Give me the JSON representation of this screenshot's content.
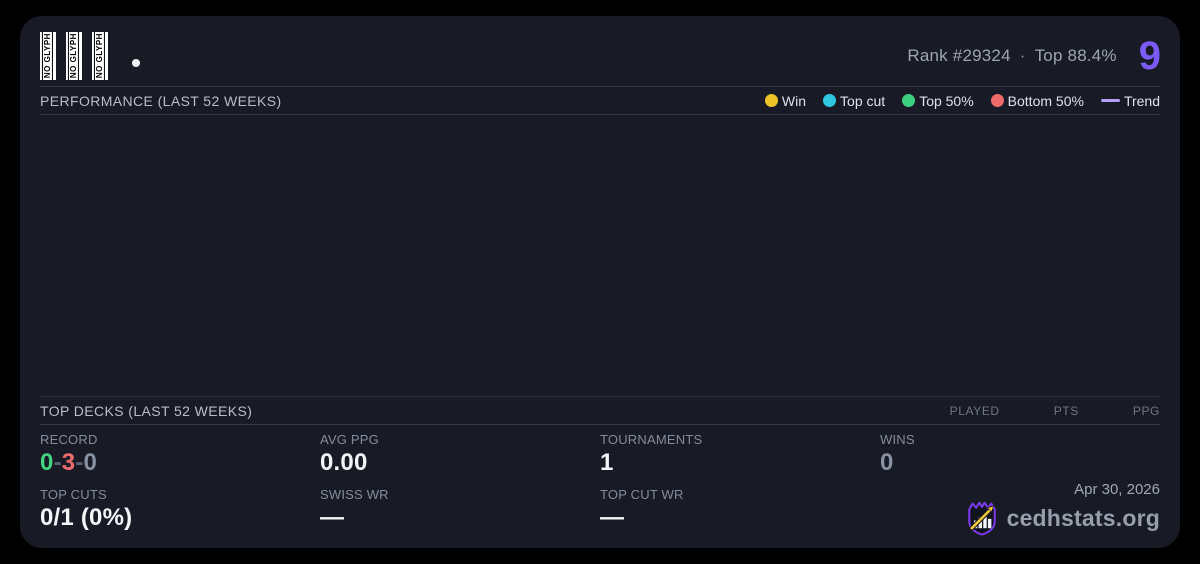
{
  "header": {
    "deck_title": {
      "missing_glyphs": [
        "NO GLYPH",
        "NO GLYPH",
        "NO GLYPH"
      ],
      "suffix_dot": "•"
    },
    "rank_text": "Rank #29324",
    "separator": "·",
    "top_percent": "Top 88.4%",
    "score": "9"
  },
  "performance": {
    "heading": "PERFORMANCE (LAST 52 WEEKS)",
    "legend": [
      {
        "label": "Win",
        "color": "#eec327",
        "shape": "dot"
      },
      {
        "label": "Top cut",
        "color": "#2fc6e2",
        "shape": "dot"
      },
      {
        "label": "Top 50%",
        "color": "#3bd07f",
        "shape": "dot"
      },
      {
        "label": "Bottom 50%",
        "color": "#ef6b6b",
        "shape": "dot"
      },
      {
        "label": "Trend",
        "color": "#b49ef5",
        "shape": "line"
      }
    ]
  },
  "chart_data": {
    "type": "scatter",
    "title": "PERFORMANCE (LAST 52 WEEKS)",
    "x": [],
    "series": [],
    "legend": [
      "Win",
      "Top cut",
      "Top 50%",
      "Bottom 50%",
      "Trend"
    ],
    "grid": false
  },
  "top_decks": {
    "heading": "TOP DECKS (LAST 52 WEEKS)",
    "columns": [
      "PLAYED",
      "PTS",
      "PPG"
    ],
    "rows": []
  },
  "stats": {
    "record": {
      "label": "RECORD",
      "win": "0",
      "loss": "3",
      "draw": "0",
      "sep": "-"
    },
    "avg_ppg": {
      "label": "AVG PPG",
      "value": "0.00"
    },
    "tournaments": {
      "label": "TOURNAMENTS",
      "value": "1"
    },
    "wins": {
      "label": "WINS",
      "value": "0"
    },
    "top_cuts": {
      "label": "TOP CUTS",
      "value": "0/1 (0%)"
    },
    "swiss_wr": {
      "label": "SWISS WR",
      "value": "—"
    },
    "top_cut_wr": {
      "label": "TOP CUT WR",
      "value": "—"
    }
  },
  "footer": {
    "date": "Apr 30, 2026",
    "brand": "cedhstats.org"
  },
  "colors": {
    "page_bg": "#000000",
    "card_bg": "#181b25",
    "divider": "#313847",
    "accent_purple": "#7c5af5",
    "win_green": "#44d47f",
    "loss_red": "#ef6c6c",
    "muted_gray": "#8791a1",
    "logo_purple": "#7c3aed",
    "logo_yellow": "#f2c93a"
  }
}
